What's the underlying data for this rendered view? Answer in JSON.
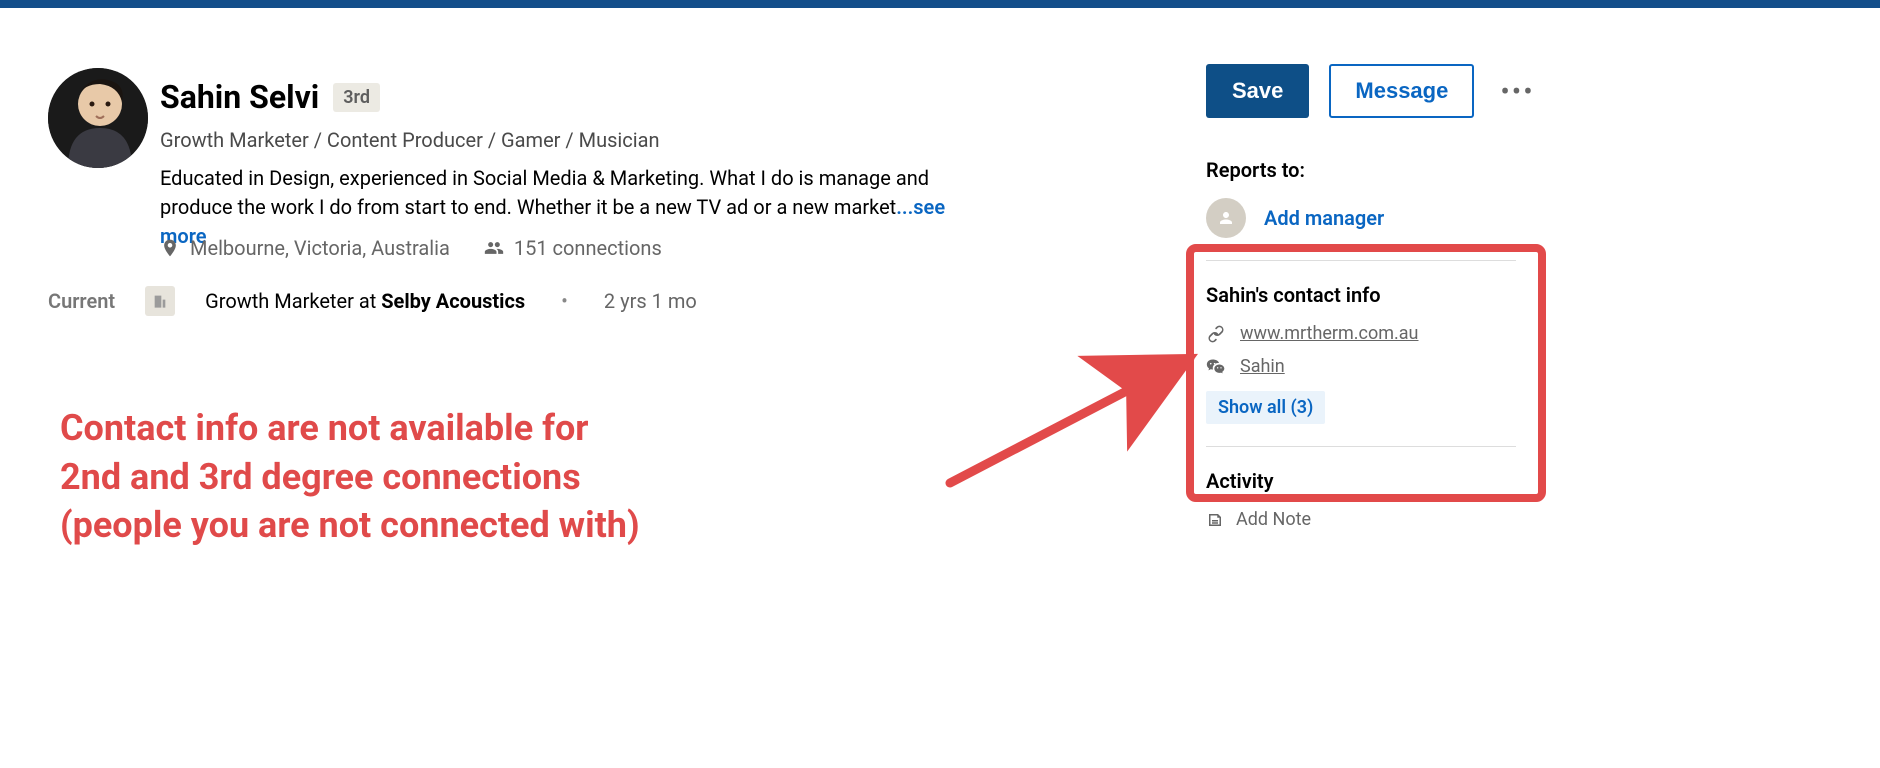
{
  "profile": {
    "name": "Sahin Selvi",
    "degree": "3rd",
    "headline": "Growth Marketer / Content Producer / Gamer / Musician",
    "bio": "Educated in Design, experienced in Social Media & Marketing. What I do is manage and produce the work I do from start to end. Whether it be a new TV ad or a new market",
    "see_more": "...see more",
    "location": "Melbourne, Victoria, Australia",
    "connections": "151 connections"
  },
  "current": {
    "label": "Current",
    "role_prefix": "Growth Marketer at ",
    "company": "Selby Acoustics",
    "tenure": "2 yrs 1 mo"
  },
  "actions": {
    "save": "Save",
    "message": "Message"
  },
  "reports_to": {
    "heading": "Reports to:",
    "add_manager": "Add manager"
  },
  "contact": {
    "heading": "Sahin's contact info",
    "website": "www.mrtherm.com.au",
    "wechat": "Sahin",
    "show_all": "Show all (3)"
  },
  "activity": {
    "heading": "Activity",
    "add_note": "Add Note"
  },
  "annotation": {
    "line1": "Contact info are not available for",
    "line2": "2nd and 3rd degree connections",
    "line3": "(people you are not connected with)"
  }
}
